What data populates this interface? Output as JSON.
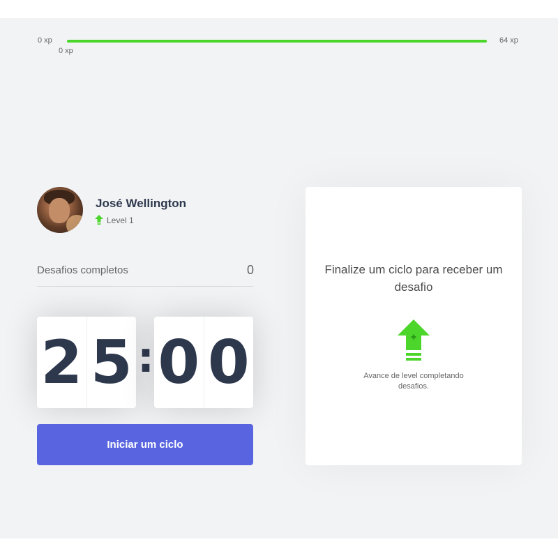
{
  "colors": {
    "background": "#f2f3f5",
    "accent_green": "#4cd62b",
    "primary_blue": "#5965e0",
    "title_text": "#2e384d",
    "body_text": "#666666"
  },
  "experience_bar": {
    "start_label": "0 xp",
    "end_label": "64 xp",
    "current_label": "0 xp",
    "progress_fraction": 1.0
  },
  "profile": {
    "name": "José Wellington",
    "level_label": "Level 1",
    "level_icon": "level-up-arrow-icon",
    "avatar_icon": "user-avatar-photo"
  },
  "completed_challenges": {
    "label": "Desafios completos",
    "count": "0"
  },
  "countdown": {
    "minute_left": "2",
    "minute_right": "5",
    "separator": ":",
    "second_left": "0",
    "second_right": "0"
  },
  "start_button": {
    "label": "Iniciar um ciclo"
  },
  "challenge_box": {
    "title": "Finalize um ciclo para receber um desafio",
    "icon": "level-up-arrow-icon",
    "hint": "Avance de level completando desafios."
  }
}
